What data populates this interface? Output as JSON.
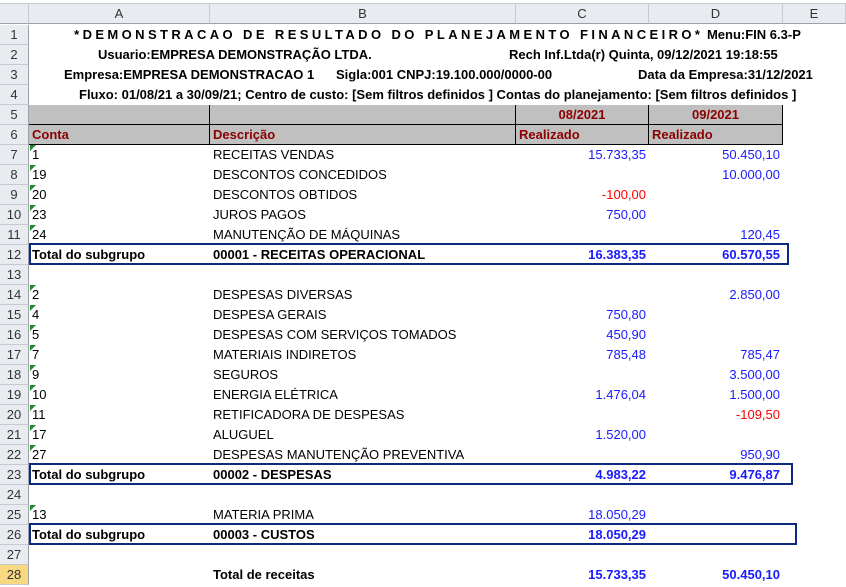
{
  "columns": [
    "A",
    "B",
    "C",
    "D",
    "E"
  ],
  "header": {
    "title": "*DEMONSTRACAO DE RESULTADO DO PLANEJAMENTO FINANCEIRO*",
    "menu": "Menu:FIN 6.3-P",
    "usuario": "Usuario:EMPRESA DEMONSTRAÇÃO LTDA.",
    "rech": "Rech Inf.Ltda(r)   Quinta, 09/12/2021 19:18:55",
    "empresa": "Empresa:EMPRESA DEMONSTRACAO 1",
    "sigla": "Sigla:001   CNPJ:19.100.000/0000-00",
    "data_empresa": "Data da Empresa:31/12/2021",
    "fluxo": "Fluxo: 01/08/21 a 30/09/21; Centro de custo: [Sem filtros definidos ] Contas do planejamento: [Sem filtros definidos ]"
  },
  "table_header": {
    "period_c": "08/2021",
    "period_d": "09/2021",
    "conta": "Conta",
    "descricao": "Descrição",
    "realizado_c": "Realizado",
    "realizado_d": "Realizado"
  },
  "colors": {
    "positive": "#1a1aff",
    "negative": "#ff0000",
    "header_text": "#8b0000",
    "box": "#0d2a80"
  },
  "rows": [
    {
      "n": "7",
      "conta": "1",
      "desc": "RECEITAS VENDAS",
      "c": "15.733,35",
      "d": "50.450,10"
    },
    {
      "n": "8",
      "conta": "19",
      "desc": "DESCONTOS CONCEDIDOS",
      "c": "",
      "d": "10.000,00"
    },
    {
      "n": "9",
      "conta": "20",
      "desc": "DESCONTOS OBTIDOS",
      "c": "-100,00",
      "d": ""
    },
    {
      "n": "10",
      "conta": "23",
      "desc": "JUROS PAGOS",
      "c": "750,00",
      "d": ""
    },
    {
      "n": "11",
      "conta": "24",
      "desc": "MANUTENÇÃO DE MÁQUINAS",
      "c": "",
      "d": "120,45"
    },
    {
      "n": "12",
      "type": "total",
      "conta": "Total do subgrupo",
      "desc": "00001 - RECEITAS OPERACIONAL",
      "c": "16.383,35",
      "d": "60.570,55"
    },
    {
      "n": "13",
      "type": "empty"
    },
    {
      "n": "14",
      "conta": "2",
      "desc": "DESPESAS DIVERSAS",
      "c": "",
      "d": "2.850,00"
    },
    {
      "n": "15",
      "conta": "4",
      "desc": "DESPESA GERAIS",
      "c": "750,80",
      "d": ""
    },
    {
      "n": "16",
      "conta": "5",
      "desc": "DESPESAS COM SERVIÇOS TOMADOS",
      "c": "450,90",
      "d": ""
    },
    {
      "n": "17",
      "conta": "7",
      "desc": "MATERIAIS INDIRETOS",
      "c": "785,48",
      "d": "785,47"
    },
    {
      "n": "18",
      "conta": "9",
      "desc": "SEGUROS",
      "c": "",
      "d": "3.500,00"
    },
    {
      "n": "19",
      "conta": "10",
      "desc": "ENERGIA ELÉTRICA",
      "c": "1.476,04",
      "d": "1.500,00"
    },
    {
      "n": "20",
      "conta": "11",
      "desc": "RETIFICADORA DE DESPESAS",
      "c": "",
      "d": "-109,50"
    },
    {
      "n": "21",
      "conta": "17",
      "desc": "ALUGUEL",
      "c": "1.520,00",
      "d": ""
    },
    {
      "n": "22",
      "conta": "27",
      "desc": "DESPESAS MANUTENÇÃO PREVENTIVA",
      "c": "",
      "d": "950,90"
    },
    {
      "n": "23",
      "type": "total",
      "conta": "Total do subgrupo",
      "desc": "00002 - DESPESAS",
      "c": "4.983,22",
      "d": "9.476,87"
    },
    {
      "n": "24",
      "type": "empty"
    },
    {
      "n": "25",
      "conta": "13",
      "desc": "MATERIA PRIMA",
      "c": "18.050,29",
      "d": ""
    },
    {
      "n": "26",
      "type": "total",
      "conta": "Total do subgrupo",
      "desc": "00003 - CUSTOS",
      "c": "18.050,29",
      "d": ""
    },
    {
      "n": "27",
      "type": "empty"
    },
    {
      "n": "28",
      "type": "grand",
      "selected": true,
      "conta": "",
      "desc": "Total de receitas",
      "c": "15.733,35",
      "d": "50.450,10"
    }
  ]
}
